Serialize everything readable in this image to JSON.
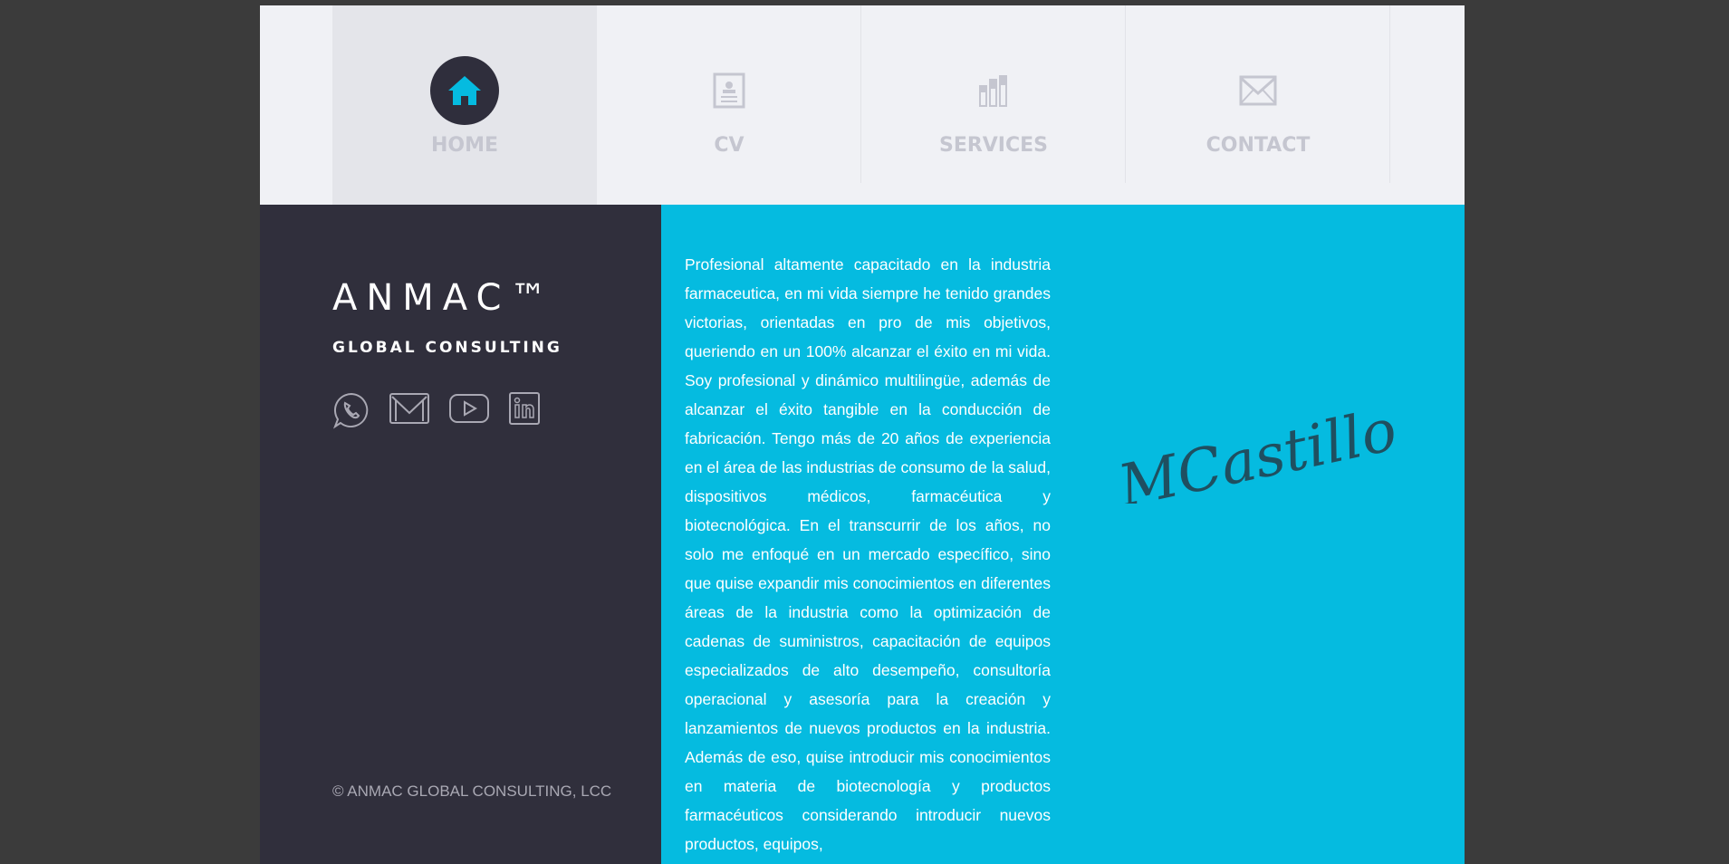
{
  "nav": {
    "items": [
      {
        "label": "HOME",
        "icon": "home-icon",
        "active": true
      },
      {
        "label": "CV",
        "icon": "document-icon",
        "active": false
      },
      {
        "label": "SERVICES",
        "icon": "bar-chart-icon",
        "active": false
      },
      {
        "label": "CONTACT",
        "icon": "envelope-icon",
        "active": false
      }
    ]
  },
  "sidebar": {
    "brand": "ANMAC™",
    "tagline": "GLOBAL CONSULTING",
    "social": [
      "whatsapp-icon",
      "mail-icon",
      "youtube-icon",
      "linkedin-icon"
    ],
    "copyright": "© ANMAC GLOBAL CONSULTING, LCC"
  },
  "main": {
    "bio": "Profesional altamente capacitado en la industria farmaceutica, en mi vida siempre he tenido grandes victorias, orientadas en pro de mis objetivos, queriendo en un 100% alcanzar el éxito en mi vida. Soy profesional y dinámico multilingüe, además de alcanzar el éxito tangible en la conducción de fabricación. Tengo más de 20 años de experiencia en el área de las industrias de consumo de la salud, dispositivos médicos, farmacéutica y biotecnológica. En el transcurrir de los años, no solo me enfoqué en un mercado específico, sino que quise expandir mis conocimientos en diferentes áreas de la industria como la optimización de cadenas de suministros, capacitación de equipos especializados de alto desempeño, consultoría operacional y asesoría para la creación y lanzamientos de nuevos productos en la industria. Además de eso, quise introducir mis conocimientos en materia de biotecnología y productos farmacéuticos considerando introducir nuevos productos, equipos,",
    "signature": "MCastillo"
  },
  "colors": {
    "accent": "#05bbe0",
    "dark": "#302f3c",
    "nav_bg": "#f0f1f5",
    "nav_active": "#e4e5ea",
    "nav_label": "#c5c6d0"
  }
}
